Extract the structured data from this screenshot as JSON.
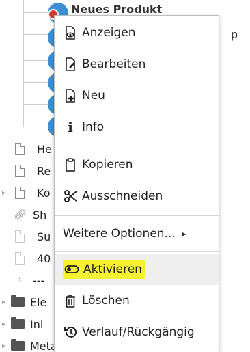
{
  "tree": {
    "top_label": "Neues Produkt",
    "right_fragment": "p",
    "rows": [
      {
        "label": "He",
        "icon": "document-icon",
        "arrow": ""
      },
      {
        "label": "Re",
        "icon": "document-icon",
        "arrow": ""
      },
      {
        "label": "Ko",
        "icon": "document-icon",
        "arrow": "▸"
      },
      {
        "label": "Sh",
        "icon": "link-icon",
        "arrow": ""
      },
      {
        "label": "Su",
        "icon": "document-icon",
        "arrow": ""
      },
      {
        "label": "40",
        "icon": "document-icon",
        "arrow": ""
      },
      {
        "label": "---",
        "icon": "spacer-icon",
        "arrow": ""
      },
      {
        "label": "Ele",
        "icon": "folder-icon",
        "arrow": "▸"
      },
      {
        "label": "Inl",
        "icon": "folder-icon",
        "arrow": "▸"
      },
      {
        "label": "Meta-Navigation",
        "icon": "folder-icon",
        "arrow": "▸"
      }
    ]
  },
  "menu": {
    "items": {
      "show": "Anzeigen",
      "edit": "Bearbeiten",
      "new": "Neu",
      "info": "Info",
      "copy": "Kopieren",
      "cut": "Ausschneiden",
      "more": "Weitere Optionen...",
      "activate": "Aktivieren",
      "delete": "Löschen",
      "history": "Verlauf/Rückgängig"
    },
    "more_chevron": "▸",
    "info_glyph": "i",
    "highlight_color": "#f6f231"
  }
}
